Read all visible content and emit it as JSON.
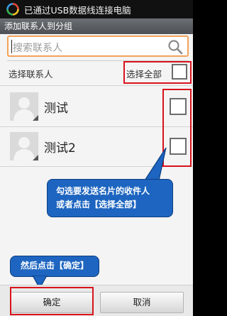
{
  "status_bar": {
    "usb_icon": "usb-connection-icon",
    "text": "已通过USB数据线连接电脑"
  },
  "title_bar": {
    "title": "添加联系人到分组"
  },
  "search": {
    "placeholder": "搜索联系人",
    "icon": "search-icon"
  },
  "select_header": {
    "label": "选择联系人",
    "select_all_label": "选择全部"
  },
  "contacts": [
    {
      "name": "测试",
      "avatar": "default-avatar-icon",
      "checked": false
    },
    {
      "name": "测试2",
      "avatar": "default-avatar-icon",
      "checked": false
    }
  ],
  "annotations": {
    "callout_select": "勾选要发送名片的收件人或者点击【选择全部】",
    "callout_select_line1": "勾选要发送名片的收件人",
    "callout_select_line2": "或者点击【选择全部】",
    "callout_confirm": "然后点击【确定】",
    "highlight_color": "#d8131c",
    "callout_color": "#1d65c0"
  },
  "buttons": {
    "ok_label": "确定",
    "cancel_label": "取消"
  }
}
